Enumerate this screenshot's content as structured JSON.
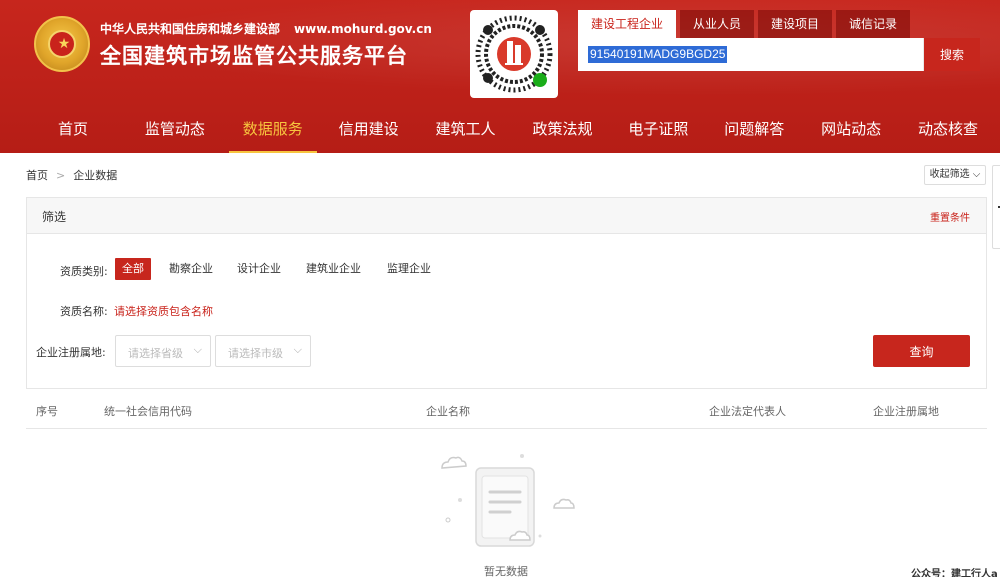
{
  "header": {
    "org_name": "中华人民共和国住房和城乡建设部",
    "org_url": "www.mohurd.gov.cn",
    "site_title": "全国建筑市场监管公共服务平台",
    "emblem_icon": "national-emblem-icon",
    "qr_icon": "mini-program-qr-icon"
  },
  "search": {
    "tabs": [
      {
        "label": "建设工程企业",
        "active": true
      },
      {
        "label": "从业人员",
        "active": false
      },
      {
        "label": "建设项目",
        "active": false
      },
      {
        "label": "诚信记录",
        "active": false
      }
    ],
    "value": "91540191MADG9BGD25",
    "button_label": "搜索"
  },
  "nav": {
    "items": [
      {
        "label": "首页",
        "active": false
      },
      {
        "label": "监管动态",
        "active": false
      },
      {
        "label": "数据服务",
        "active": true
      },
      {
        "label": "信用建设",
        "active": false
      },
      {
        "label": "建筑工人",
        "active": false
      },
      {
        "label": "政策法规",
        "active": false
      },
      {
        "label": "电子证照",
        "active": false
      },
      {
        "label": "问题解答",
        "active": false
      },
      {
        "label": "网站动态",
        "active": false
      },
      {
        "label": "动态核查",
        "active": false
      }
    ]
  },
  "breadcrumb": {
    "home": "首页",
    "separator": ">",
    "current": "企业数据"
  },
  "collapse_label": "收起筛选",
  "filter": {
    "title": "筛选",
    "reset_label": "重置条件",
    "qual_type_label": "资质类别:",
    "qual_types": [
      {
        "label": "全部",
        "active": true
      },
      {
        "label": "勘察企业",
        "active": false
      },
      {
        "label": "设计企业",
        "active": false
      },
      {
        "label": "建筑业企业",
        "active": false
      },
      {
        "label": "监理企业",
        "active": false
      }
    ],
    "qual_name_label": "资质名称:",
    "qual_name_placeholder": "请选择资质包含名称",
    "region_label": "企业注册属地:",
    "province_placeholder": "请选择省级",
    "city_placeholder": "请选择市级",
    "query_label": "查询"
  },
  "table": {
    "columns": [
      "序号",
      "统一社会信用代码",
      "企业名称",
      "企业法定代表人",
      "企业注册属地"
    ]
  },
  "empty_state": {
    "text": "暂无数据",
    "icon": "empty-document-icon"
  },
  "watermark": "公众号：建工行人a",
  "colors": {
    "brand_red": "#c7261d",
    "active_nav": "#f7c53f",
    "selection_blue": "#2e6bd6"
  }
}
